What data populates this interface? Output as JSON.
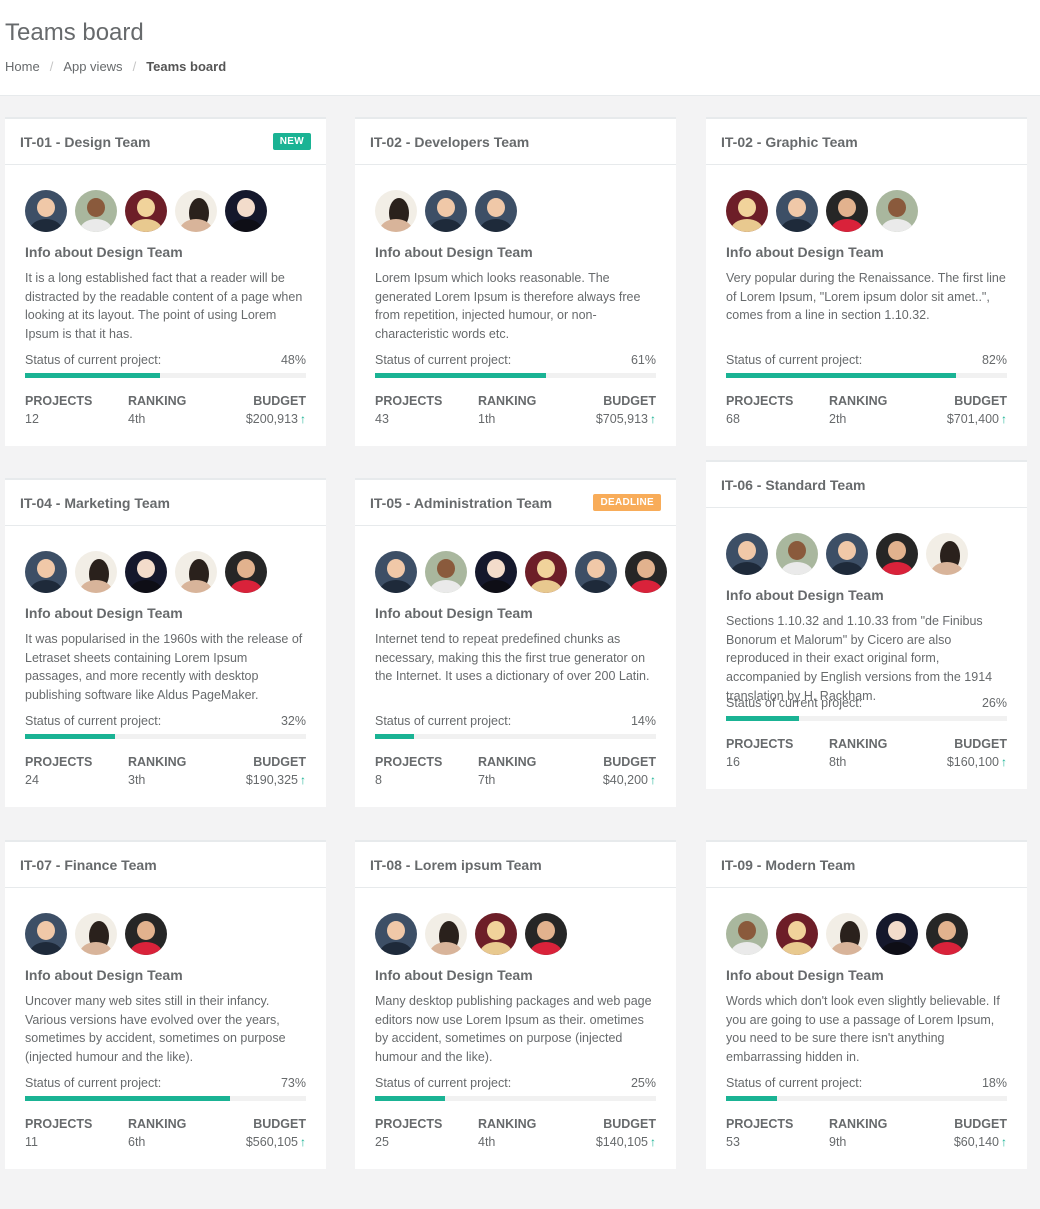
{
  "page": {
    "title": "Teams board",
    "breadcrumb": [
      "Home",
      "App views",
      "Teams board"
    ]
  },
  "labels": {
    "info_title": "Info about Design Team",
    "status": "Status of current project:",
    "projects": "PROJECTS",
    "ranking": "RANKING",
    "budget": "BUDGET"
  },
  "colors": {
    "accent": "#1ab394",
    "badge_new": "#1ab394",
    "badge_deadline": "#f8ac59"
  },
  "icons": {
    "budget_trend": "arrow-up-icon"
  },
  "teams": [
    {
      "name": "IT-01 - Design Team",
      "badge": "NEW",
      "members": [
        "man-beard",
        "man-dark",
        "woman-blonde",
        "woman-dark-hair",
        "woman-asian"
      ],
      "description": "It is a long established fact that a reader will be distracted by the readable content of a page when looking at its layout. The point of using Lorem Ipsum is that it has.",
      "progress": "48%",
      "projects": "12",
      "ranking": "4th",
      "budget": "$200,913"
    },
    {
      "name": "IT-02 - Developers Team",
      "badge": "",
      "members": [
        "woman-dark-hair",
        "man-beard-light",
        "man-beard"
      ],
      "description": "Lorem Ipsum which looks reasonable. The generated Lorem Ipsum is therefore always free from repetition, injected humour, or non-characteristic words etc.",
      "progress": "61%",
      "projects": "43",
      "ranking": "1th",
      "budget": "$705,913"
    },
    {
      "name": "IT-02 - Graphic Team",
      "badge": "",
      "members": [
        "woman-blonde",
        "man-beard-light",
        "man-red-shirt",
        "man-dark"
      ],
      "description": "Very popular during the Renaissance. The first line of Lorem Ipsum, \"Lorem ipsum dolor sit amet..\", comes from a line in section 1.10.32.",
      "progress": "82%",
      "projects": "68",
      "ranking": "2th",
      "budget": "$701,400"
    },
    {
      "name": "IT-04 - Marketing Team",
      "badge": "",
      "members": [
        "man-beard-light",
        "woman-dark-hair",
        "woman-asian",
        "woman-dark-hair",
        "man-red-shirt"
      ],
      "description": "It was popularised in the 1960s with the release of Letraset sheets containing Lorem Ipsum passages, and more recently with desktop publishing software like Aldus PageMaker.",
      "progress": "32%",
      "projects": "24",
      "ranking": "3th",
      "budget": "$190,325"
    },
    {
      "name": "IT-05 - Administration Team",
      "badge": "DEADLINE",
      "members": [
        "man-beard",
        "man-dark",
        "woman-asian",
        "woman-blonde",
        "man-beard-light",
        "man-red-shirt"
      ],
      "description": "Internet tend to repeat predefined chunks as necessary, making this the first true generator on the Internet. It uses a dictionary of over 200 Latin.",
      "progress": "14%",
      "projects": "8",
      "ranking": "7th",
      "budget": "$40,200"
    },
    {
      "name": "IT-06 - Standard Team",
      "badge": "",
      "members": [
        "man-beard",
        "man-dark",
        "man-beard-light",
        "man-red-shirt",
        "woman-dark-hair"
      ],
      "description": "Sections 1.10.32 and 1.10.33 from \"de Finibus Bonorum et Malorum\" by Cicero are also reproduced in their exact original form, accompanied by English versions from the 1914 translation by H. Rackham.",
      "progress": "26%",
      "projects": "16",
      "ranking": "8th",
      "budget": "$160,100"
    },
    {
      "name": "IT-07 - Finance Team",
      "badge": "",
      "members": [
        "man-beard-light",
        "woman-dark-hair",
        "man-red-shirt"
      ],
      "description": "Uncover many web sites still in their infancy. Various versions have evolved over the years, sometimes by accident, sometimes on purpose (injected humour and the like).",
      "progress": "73%",
      "projects": "11",
      "ranking": "6th",
      "budget": "$560,105"
    },
    {
      "name": "IT-08 - Lorem ipsum Team",
      "badge": "",
      "members": [
        "man-beard",
        "woman-dark-hair",
        "woman-blonde",
        "man-red-shirt"
      ],
      "description": "Many desktop publishing packages and web page editors now use Lorem Ipsum as their. ometimes by accident, sometimes on purpose (injected humour and the like).",
      "progress": "25%",
      "projects": "25",
      "ranking": "4th",
      "budget": "$140,105"
    },
    {
      "name": "IT-09 - Modern Team",
      "badge": "",
      "members": [
        "man-dark",
        "woman-blonde",
        "woman-dark-hair",
        "woman-asian",
        "man-red-shirt"
      ],
      "description": "Words which don't look even slightly believable. If you are going to use a passage of Lorem Ipsum, you need to be sure there isn't anything embarrassing hidden in.",
      "progress": "18%",
      "projects": "53",
      "ranking": "9th",
      "budget": "$60,140"
    }
  ]
}
